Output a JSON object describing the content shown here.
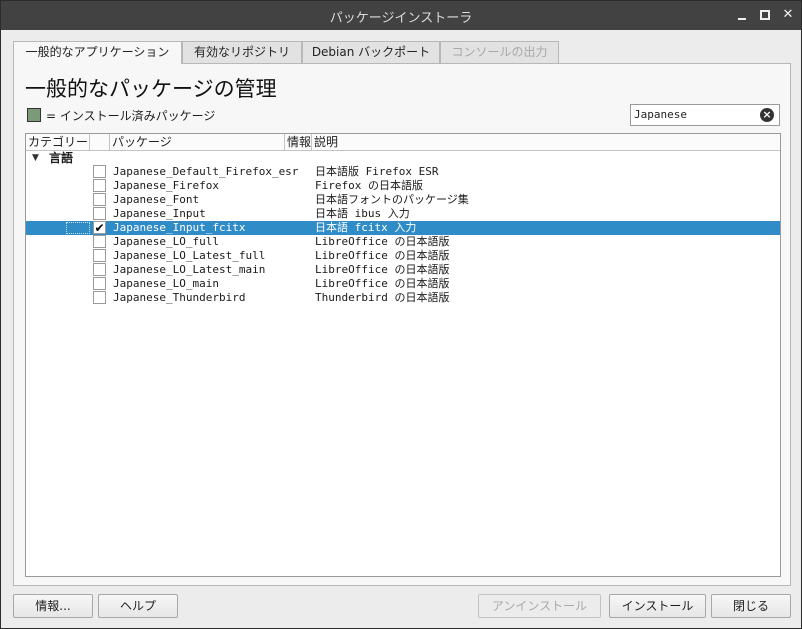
{
  "window": {
    "title": "パッケージインストーラ"
  },
  "tabs": [
    {
      "label": "一般的なアプリケーション",
      "state": "active"
    },
    {
      "label": "有効なリポジトリ",
      "state": "normal"
    },
    {
      "label": "Debian バックポート",
      "state": "normal"
    },
    {
      "label": "コンソールの出力",
      "state": "disabled"
    }
  ],
  "panel": {
    "heading": "一般的なパッケージの管理",
    "legend": "= インストール済みパッケージ",
    "legend_color": "#7a9a78",
    "search_value": "Japanese",
    "clear_icon": "×"
  },
  "tree": {
    "headers": {
      "category": "カテゴリー",
      "package": "パッケージ",
      "info": "情報",
      "description": "説明"
    },
    "group": {
      "label": "言語",
      "expanded": true,
      "arrow": "▼"
    },
    "rows": [
      {
        "name": "Japanese_Default_Firefox_esr",
        "desc": "日本語版 Firefox ESR",
        "checked": false
      },
      {
        "name": "Japanese_Firefox",
        "desc": "Firefox の日本語版",
        "checked": false
      },
      {
        "name": "Japanese_Font",
        "desc": "日本語フォントのパッケージ集",
        "checked": false
      },
      {
        "name": "Japanese_Input",
        "desc": "日本語 ibus 入力",
        "checked": false
      },
      {
        "name": "Japanese_Input_fcitx",
        "desc": "日本語 fcitx 入力",
        "checked": true,
        "selected": true
      },
      {
        "name": "Japanese_LO_full",
        "desc": "LibreOffice の日本語版",
        "checked": false
      },
      {
        "name": "Japanese_LO_Latest_full",
        "desc": "LibreOffice の日本語版",
        "checked": false
      },
      {
        "name": "Japanese_LO_Latest_main",
        "desc": "LibreOffice の日本語版",
        "checked": false
      },
      {
        "name": "Japanese_LO_main",
        "desc": "LibreOffice の日本語版",
        "checked": false
      },
      {
        "name": "Japanese_Thunderbird",
        "desc": "Thunderbird の日本語版",
        "checked": false
      }
    ],
    "selection_color": "#308cc6"
  },
  "buttons": {
    "info": "情報...",
    "help": "ヘルプ",
    "uninstall": "アンインストール",
    "install": "インストール",
    "close": "閉じる"
  },
  "check_glyph": "✔"
}
